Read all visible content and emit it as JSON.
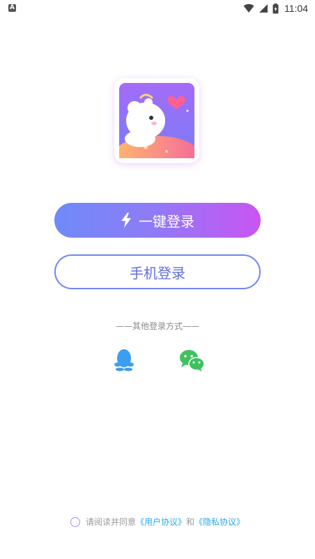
{
  "status_bar": {
    "left_icon": "A",
    "time": "11:04"
  },
  "icons": {
    "notification": "a-letter-icon",
    "wifi": "wifi-icon",
    "signal": "signal-icon",
    "battery": "battery-charging-icon",
    "lightning": "lightning-icon",
    "qq": "qq-penguin-icon",
    "wechat": "wechat-icon"
  },
  "login": {
    "quick_label": "一键登录",
    "phone_label": "手机登录",
    "other_title": "——其他登录方式——"
  },
  "agreement": {
    "prefix": "请阅读并同意",
    "user_agreement": "《用户协议》",
    "and": "和",
    "privacy_agreement": "《隐私协议》"
  },
  "colors": {
    "gradient_start": "#6f8af8",
    "gradient_end": "#c955f2",
    "phone_border": "#6f84f2",
    "link": "#29a9f0",
    "qq": "#3d9df0",
    "wechat": "#3fc25e"
  }
}
